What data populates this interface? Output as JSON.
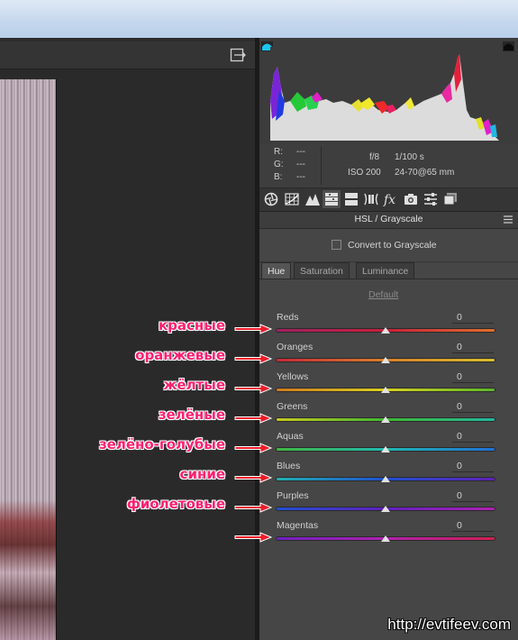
{
  "readout": {
    "r_label": "R:",
    "g_label": "G:",
    "b_label": "B:",
    "r_value": "---",
    "g_value": "---",
    "b_value": "---",
    "aperture": "f/8",
    "shutter": "1/100 s",
    "iso": "ISO 200",
    "lens": "24-70@65 mm"
  },
  "tool_tabs": [
    {
      "icon": "aperture-icon"
    },
    {
      "icon": "tone-curve-icon"
    },
    {
      "icon": "detail-icon"
    },
    {
      "icon": "hsl-icon",
      "active": true
    },
    {
      "icon": "split-toning-icon"
    },
    {
      "icon": "lens-corrections-icon"
    },
    {
      "icon": "fx-icon"
    },
    {
      "icon": "camera-calibration-icon"
    },
    {
      "icon": "presets-icon"
    },
    {
      "icon": "snapshots-icon"
    }
  ],
  "section": {
    "title": "HSL / Grayscale"
  },
  "convert": {
    "label": "Convert to Grayscale",
    "checked": false
  },
  "subtabs": {
    "hue": "Hue",
    "saturation": "Saturation",
    "luminance": "Luminance",
    "active": "Hue"
  },
  "default_link": "Default",
  "sliders": [
    {
      "label": "Reds",
      "value": "0",
      "annotation": "красные",
      "track": [
        "#a02060",
        "#c8203c",
        "#e0702a"
      ]
    },
    {
      "label": "Oranges",
      "value": "0",
      "annotation": "оранжевые",
      "track": [
        "#c82838",
        "#d8802a",
        "#d8c02a"
      ]
    },
    {
      "label": "Yellows",
      "value": "0",
      "annotation": "жёлтые",
      "track": [
        "#d07a20",
        "#d8d020",
        "#5ab82a"
      ]
    },
    {
      "label": "Greens",
      "value": "0",
      "annotation": "зелёные",
      "track": [
        "#c8c820",
        "#40b830",
        "#20b8a0"
      ]
    },
    {
      "label": "Aquas",
      "value": "0",
      "annotation": "зелёно-голубые",
      "track": [
        "#40b840",
        "#20b8b0",
        "#2070d8"
      ]
    },
    {
      "label": "Blues",
      "value": "0",
      "annotation": "синие",
      "track": [
        "#20b0b0",
        "#2050d0",
        "#6020b8"
      ]
    },
    {
      "label": "Purples",
      "value": "0",
      "annotation": "фиолетовые",
      "track": [
        "#2050d0",
        "#6020c0",
        "#b020b0"
      ]
    },
    {
      "label": "Magentas",
      "value": "0",
      "annotation": "",
      "track": [
        "#7020c0",
        "#b020b0",
        "#d02050"
      ]
    }
  ],
  "watermark": "http://evtifeev.com",
  "colors": {
    "panel": "#464646",
    "annotation": "#ff1f6e",
    "shadow_clip": "#19c8f0"
  }
}
